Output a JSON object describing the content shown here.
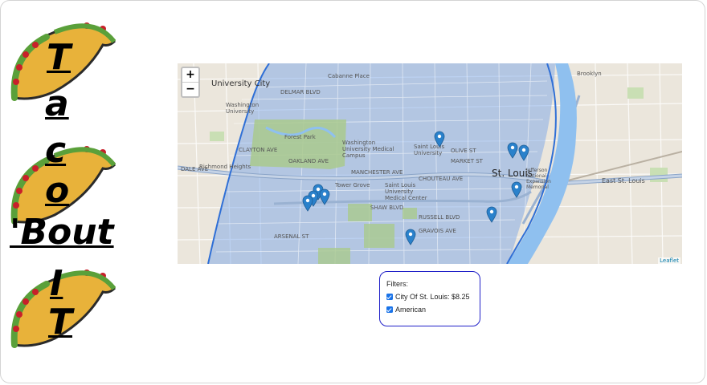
{
  "title": {
    "letters": [
      "T",
      "a",
      "c",
      "o",
      "'Bout",
      "I",
      "T"
    ]
  },
  "map": {
    "zoom_in_label": "+",
    "zoom_out_label": "−",
    "attribution": "Leaflet",
    "labels": {
      "university_city": "University City",
      "brooklyn": "Brooklyn",
      "richmond_heights": "Richmond Heights",
      "st_louis": "St. Louis",
      "east_st_louis": "East St. Louis",
      "forest_park": "Forest Park",
      "cabanne_place": "Cabanne Place",
      "washington_university_medical_campus": "Washington University Medical Campus",
      "saint_louis_university": "Saint Louis University",
      "slu_medical_center": "Saint Louis University Medical Center",
      "tower_grove": "Tower Grove",
      "washington_university": "Washington University",
      "dale_ave": "DALE AVE",
      "manchester_ave": "MANCHESTER AVE",
      "market_st": "MARKET ST",
      "chouteau_ave": "CHOUTEAU AVE",
      "shaw_blvd": "SHAW BLVD",
      "russell_blvd": "RUSSELL BLVD",
      "gravois_ave": "GRAVOIS AVE",
      "arsenal_st": "ARSENAL ST",
      "clayton_ave": "CLAYTON AVE",
      "oakland_ave": "OAKLAND AVE",
      "delmar_blvd": "DELMAR BLVD",
      "olive_st": "OLIVE ST",
      "jefferson_memorial": "Jefferson National Expansion Memorial"
    },
    "marker_count": 10
  },
  "filters": {
    "heading": "Filters:",
    "items": [
      {
        "label": "City Of St. Louis: $8.25",
        "checked": true
      },
      {
        "label": "American",
        "checked": true
      }
    ]
  },
  "colors": {
    "map_highlight": "#6fa0e8",
    "boundary": "#2f6fd6",
    "river": "#8fc0ef",
    "marker": "#2a81cb",
    "filter_border": "#2020c8",
    "taco_shell": "#e8b23a",
    "lettuce": "#5aa03a",
    "tomato": "#c8202a"
  }
}
